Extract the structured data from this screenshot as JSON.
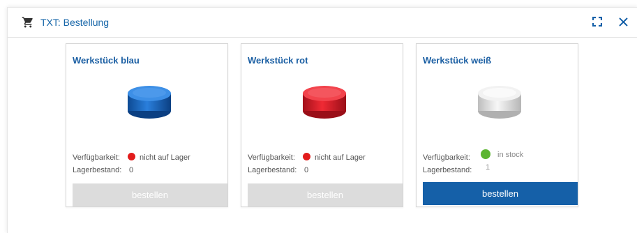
{
  "window": {
    "title": "TXT: Bestellung",
    "icons": {
      "cart": "shopping-cart-icon",
      "fullscreen": "fullscreen-icon",
      "close": "close-icon"
    }
  },
  "labels": {
    "availability": "Verfügbarkeit:",
    "stock": "Lagerbestand:"
  },
  "cards": [
    {
      "title": "Werkstück blau",
      "availability": "nicht auf Lager",
      "status_color": "#e21c1c",
      "stock": "0",
      "button": "bestellen",
      "button_enabled": false,
      "piece_color": "#1d6cc4"
    },
    {
      "title": "Werkstück rot",
      "availability": "nicht auf Lager",
      "status_color": "#e21c1c",
      "stock": "0",
      "button": "bestellen",
      "button_enabled": false,
      "piece_color": "#e02030"
    },
    {
      "title": "Werkstück weiß",
      "availability": "in stock",
      "status_color": "#5cb531",
      "stock": "1",
      "button": "bestellen",
      "button_enabled": true,
      "piece_color": "#e8e8e8"
    }
  ],
  "colors": {
    "accent": "#1560a8",
    "disabled_button": "#dcdcdc"
  }
}
